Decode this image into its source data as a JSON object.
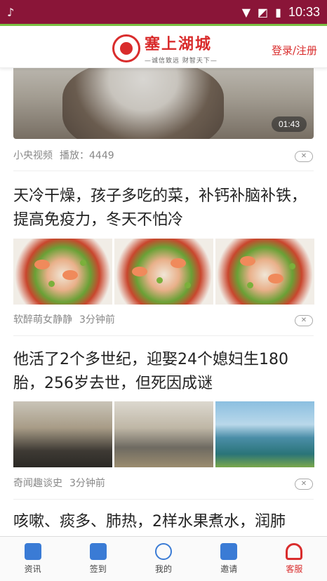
{
  "status_bar": {
    "time": "10:33"
  },
  "header": {
    "logo_title": "塞上湖城",
    "logo_subtitle": "—诚信致远 财智天下—",
    "login_link": "登录/注册"
  },
  "feed": [
    {
      "type": "video",
      "duration": "01:43",
      "source": "小央视频",
      "stat": "播放：4449"
    },
    {
      "type": "article",
      "title": "天冷干燥，孩子多吃的菜，补钙补脑补铁，提高免疫力，冬天不怕冷",
      "source": "软醉萌女静静",
      "time": "3分钟前"
    },
    {
      "type": "article",
      "title": "他活了2个多世纪，迎娶24个媳妇生180胎，256岁去世，但死因成谜",
      "source": "奇闻趣谈史",
      "time": "3分钟前"
    },
    {
      "type": "article",
      "title": "咳嗽、痰多、肺热，2样水果煮水，润肺"
    }
  ],
  "tabs": [
    {
      "label": "资讯",
      "icon": "news-icon",
      "color": "#3a7bd5"
    },
    {
      "label": "签到",
      "icon": "checkin-icon",
      "color": "#3a7bd5"
    },
    {
      "label": "我的",
      "icon": "profile-icon",
      "color": "#3a7bd5"
    },
    {
      "label": "邀请",
      "icon": "invite-icon",
      "color": "#3a7bd5"
    },
    {
      "label": "客服",
      "icon": "headset-icon",
      "color": "#d92c2c"
    }
  ],
  "colors": {
    "brand": "#d92c2c",
    "status_bar": "#8a1538"
  }
}
